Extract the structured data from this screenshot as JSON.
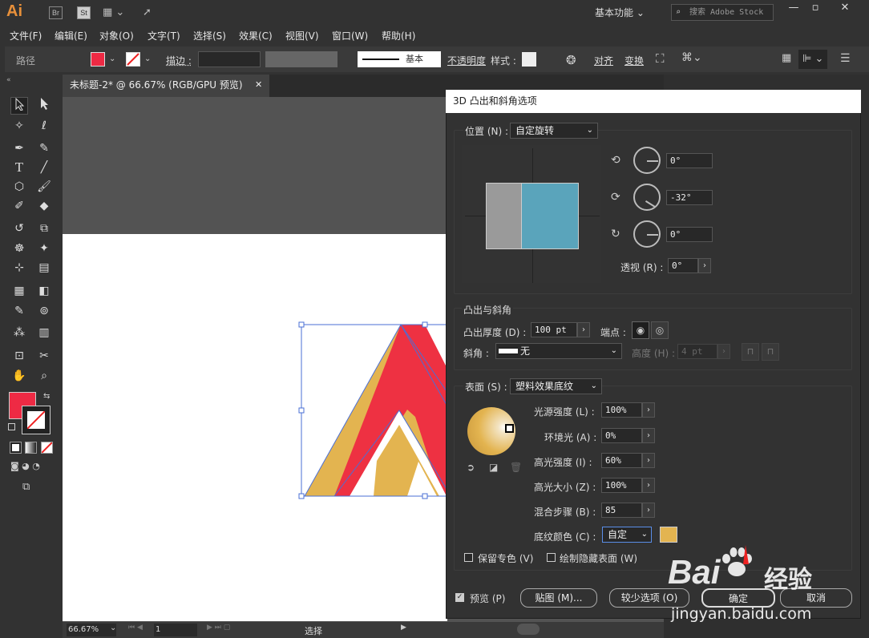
{
  "app": {
    "logo": "Ai",
    "br": "Br",
    "st": "St",
    "workspace": "基本功能",
    "search_placeholder": "搜索 Adobe Stock"
  },
  "menu": [
    "文件(F)",
    "编辑(E)",
    "对象(O)",
    "文字(T)",
    "选择(S)",
    "效果(C)",
    "视图(V)",
    "窗口(W)",
    "帮助(H)"
  ],
  "control": {
    "object_type": "路径",
    "stroke_label": "描边 :",
    "stroke_style": "基本",
    "opacity_label": "不透明度",
    "style_label": "样式 :",
    "align": "对齐",
    "transform": "变换",
    "fill_color": "#ee2a44"
  },
  "document_tab": {
    "title": "未标题-2* @ 66.67% (RGB/GPU 预览)"
  },
  "status": {
    "zoom": "66.67%",
    "page": "1",
    "tool": "选择"
  },
  "dialog": {
    "title": "3D 凸出和斜角选项",
    "position": {
      "label": "位置 (N) :",
      "value": "自定旋转"
    },
    "rotation": {
      "x": "0°",
      "y": "-32°",
      "z": "0°"
    },
    "perspective": {
      "label": "透视 (R) :",
      "value": "0°"
    },
    "extrude": {
      "section": "凸出与斜角",
      "depth_label": "凸出厚度 (D) :",
      "depth": "100 pt",
      "cap_label": "端点 :",
      "bevel_label": "斜角 :",
      "bevel": "无",
      "height_label": "高度 (H) :",
      "height": "4 pt"
    },
    "surface": {
      "label": "表面 (S) :",
      "value": "塑料效果底纹",
      "rows": [
        {
          "label": "光源强度 (L) :",
          "value": "100%"
        },
        {
          "label": "环境光 (A) :",
          "value": "0%"
        },
        {
          "label": "高光强度 (I) :",
          "value": "60%"
        },
        {
          "label": "高光大小 (Z) :",
          "value": "100%"
        },
        {
          "label": "混合步骤 (B) :",
          "value": "85"
        }
      ],
      "shade_label": "底纹颜色 (C) :",
      "shade_value": "自定",
      "shade_color": "#e3b450"
    },
    "preserve_spot": "保留专色 (V)",
    "draw_hidden": "绘制隐藏表面 (W)",
    "preview": "预览 (P)",
    "map": "贴图 (M)...",
    "fewer": "较少选项 (O)",
    "ok": "确定",
    "cancel": "取消"
  },
  "colors": {
    "yellow": "#e3b450",
    "red": "#ee3142",
    "front_face": "#5aa4bb",
    "side_face": "#9a9a9a"
  },
  "watermark": {
    "brand": "Bai",
    "brand2": "经验",
    "url": "jingyan.baidu.com"
  }
}
